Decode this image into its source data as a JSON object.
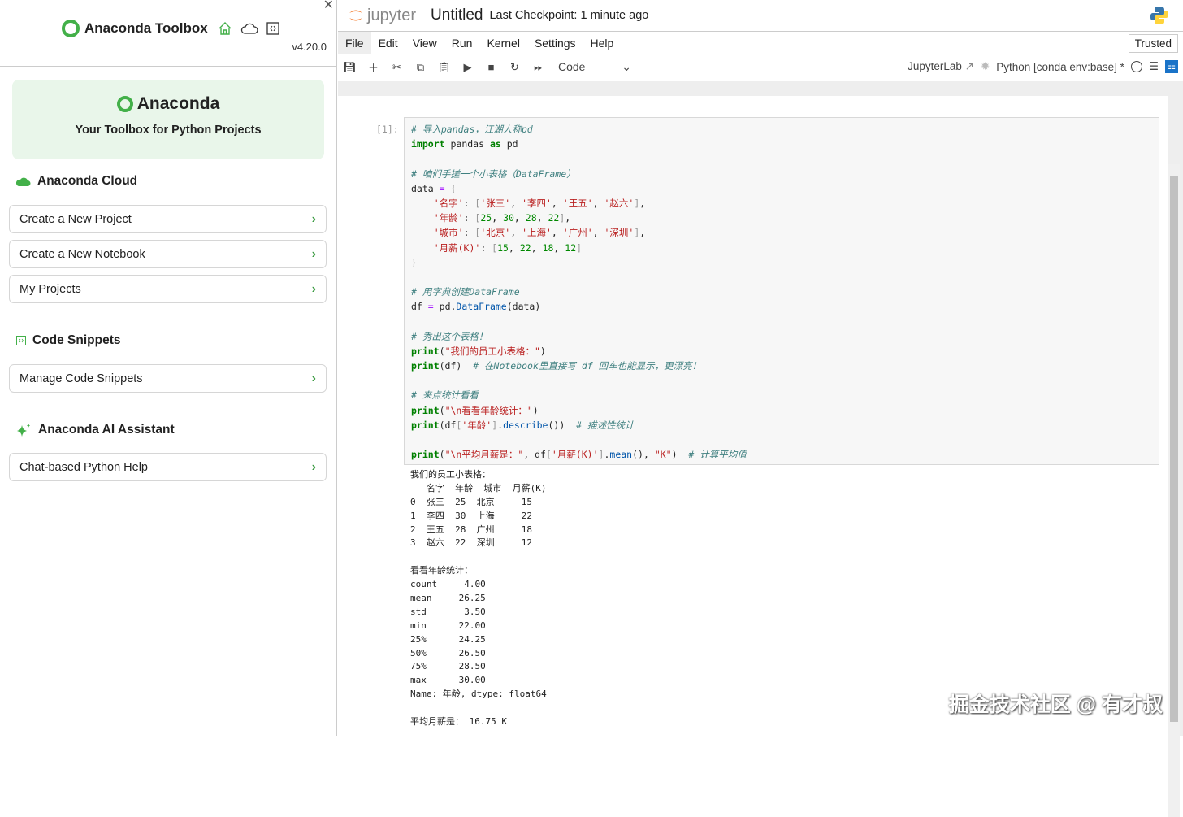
{
  "toolbox": {
    "title": "Anaconda Toolbox",
    "version": "v4.20.0",
    "hero_title": "Anaconda",
    "hero_subtitle": "Your Toolbox for Python Projects",
    "sections": [
      {
        "title": "Anaconda Cloud",
        "icon": "cloud-icon",
        "items": [
          "Create a New Project",
          "Create a New Notebook",
          "My Projects"
        ]
      },
      {
        "title": "Code Snippets",
        "icon": "code-icon",
        "items": [
          "Manage Code Snippets"
        ]
      },
      {
        "title": "Anaconda AI Assistant",
        "icon": "sparkle-icon",
        "items": [
          "Chat-based Python Help"
        ]
      }
    ],
    "accent": "#43b049"
  },
  "jupyter": {
    "logo": "jupyter",
    "notebook_title": "Untitled",
    "checkpoint": "Last Checkpoint: 1 minute ago",
    "menu": [
      "File",
      "Edit",
      "View",
      "Run",
      "Kernel",
      "Settings",
      "Help"
    ],
    "trusted": "Trusted",
    "cell_type": "Code",
    "jupyterlab": "JupyterLab",
    "kernel": "Python [conda env:base] *"
  },
  "cell": {
    "prompt": "[1]:",
    "code": [
      [
        [
          "c",
          "# 导入pandas，江湖人称pd"
        ]
      ],
      [
        [
          "k",
          "import"
        ],
        [
          "t",
          " pandas "
        ],
        [
          "k",
          "as"
        ],
        [
          "t",
          " pd"
        ]
      ],
      [],
      [
        [
          "c",
          "# 咱们手搓一个小表格（DataFrame）"
        ]
      ],
      [
        [
          "t",
          "data "
        ],
        [
          "o",
          "="
        ],
        [
          "p",
          " {"
        ]
      ],
      [
        [
          "s",
          "    '名字'"
        ],
        [
          "t",
          ": "
        ],
        [
          "p",
          "["
        ],
        [
          "s",
          "'张三'"
        ],
        [
          "t",
          ", "
        ],
        [
          "s",
          "'李四'"
        ],
        [
          "t",
          ", "
        ],
        [
          "s",
          "'王五'"
        ],
        [
          "t",
          ", "
        ],
        [
          "s",
          "'赵六'"
        ],
        [
          "p",
          "]"
        ],
        [
          "t",
          ","
        ]
      ],
      [
        [
          "s",
          "    '年龄'"
        ],
        [
          "t",
          ": "
        ],
        [
          "p",
          "["
        ],
        [
          "n",
          "25"
        ],
        [
          "t",
          ", "
        ],
        [
          "n",
          "30"
        ],
        [
          "t",
          ", "
        ],
        [
          "n",
          "28"
        ],
        [
          "t",
          ", "
        ],
        [
          "n",
          "22"
        ],
        [
          "p",
          "]"
        ],
        [
          "t",
          ","
        ]
      ],
      [
        [
          "s",
          "    '城市'"
        ],
        [
          "t",
          ": "
        ],
        [
          "p",
          "["
        ],
        [
          "s",
          "'北京'"
        ],
        [
          "t",
          ", "
        ],
        [
          "s",
          "'上海'"
        ],
        [
          "t",
          ", "
        ],
        [
          "s",
          "'广州'"
        ],
        [
          "t",
          ", "
        ],
        [
          "s",
          "'深圳'"
        ],
        [
          "p",
          "]"
        ],
        [
          "t",
          ","
        ]
      ],
      [
        [
          "s",
          "    '月薪(K)'"
        ],
        [
          "t",
          ": "
        ],
        [
          "p",
          "["
        ],
        [
          "n",
          "15"
        ],
        [
          "t",
          ", "
        ],
        [
          "n",
          "22"
        ],
        [
          "t",
          ", "
        ],
        [
          "n",
          "18"
        ],
        [
          "t",
          ", "
        ],
        [
          "n",
          "12"
        ],
        [
          "p",
          "]"
        ]
      ],
      [
        [
          "p",
          "}"
        ]
      ],
      [],
      [
        [
          "c",
          "# 用字典创建DataFrame"
        ]
      ],
      [
        [
          "t",
          "df "
        ],
        [
          "o",
          "="
        ],
        [
          "t",
          " pd."
        ],
        [
          "m",
          "DataFrame"
        ],
        [
          "t",
          "(data)"
        ]
      ],
      [],
      [
        [
          "c",
          "# 秀出这个表格！"
        ]
      ],
      [
        [
          "k",
          "print"
        ],
        [
          "t",
          "("
        ],
        [
          "s",
          "\"我们的员工小表格：\""
        ],
        [
          "t",
          ")"
        ]
      ],
      [
        [
          "k",
          "print"
        ],
        [
          "t",
          "(df)  "
        ],
        [
          "c",
          "# 在Notebook里直接写 df 回车也能显示，更漂亮！"
        ]
      ],
      [],
      [
        [
          "c",
          "# 来点统计看看"
        ]
      ],
      [
        [
          "k",
          "print"
        ],
        [
          "t",
          "("
        ],
        [
          "s",
          "\"\\n看看年龄统计：\""
        ],
        [
          "t",
          ")"
        ]
      ],
      [
        [
          "k",
          "print"
        ],
        [
          "t",
          "(df"
        ],
        [
          "p",
          "["
        ],
        [
          "s",
          "'年龄'"
        ],
        [
          "p",
          "]"
        ],
        [
          "t",
          "."
        ],
        [
          "m",
          "describe"
        ],
        [
          "t",
          "())  "
        ],
        [
          "c",
          "# 描述性统计"
        ]
      ],
      [],
      [
        [
          "k",
          "print"
        ],
        [
          "t",
          "("
        ],
        [
          "s",
          "\"\\n平均月薪是：\""
        ],
        [
          "t",
          ", df"
        ],
        [
          "p",
          "["
        ],
        [
          "s",
          "'月薪(K)'"
        ],
        [
          "p",
          "]"
        ],
        [
          "t",
          "."
        ],
        [
          "m",
          "mean"
        ],
        [
          "t",
          "(), "
        ],
        [
          "s",
          "\"K\""
        ],
        [
          "t",
          ")  "
        ],
        [
          "c",
          "# 计算平均值"
        ]
      ]
    ],
    "output": [
      "我们的员工小表格：",
      "   名字  年龄  城市  月薪(K)",
      "0  张三  25  北京     15",
      "1  李四  30  上海     22",
      "2  王五  28  广州     18",
      "3  赵六  22  深圳     12",
      "",
      "看看年龄统计：",
      "count     4.00",
      "mean     26.25",
      "std       3.50",
      "min      22.00",
      "25%      24.25",
      "50%      26.50",
      "75%      28.50",
      "max      30.00",
      "Name: 年龄, dtype: float64",
      "",
      "平均月薪是： 16.75 K"
    ]
  },
  "watermark": "掘金技术社区 @ 有才叔"
}
